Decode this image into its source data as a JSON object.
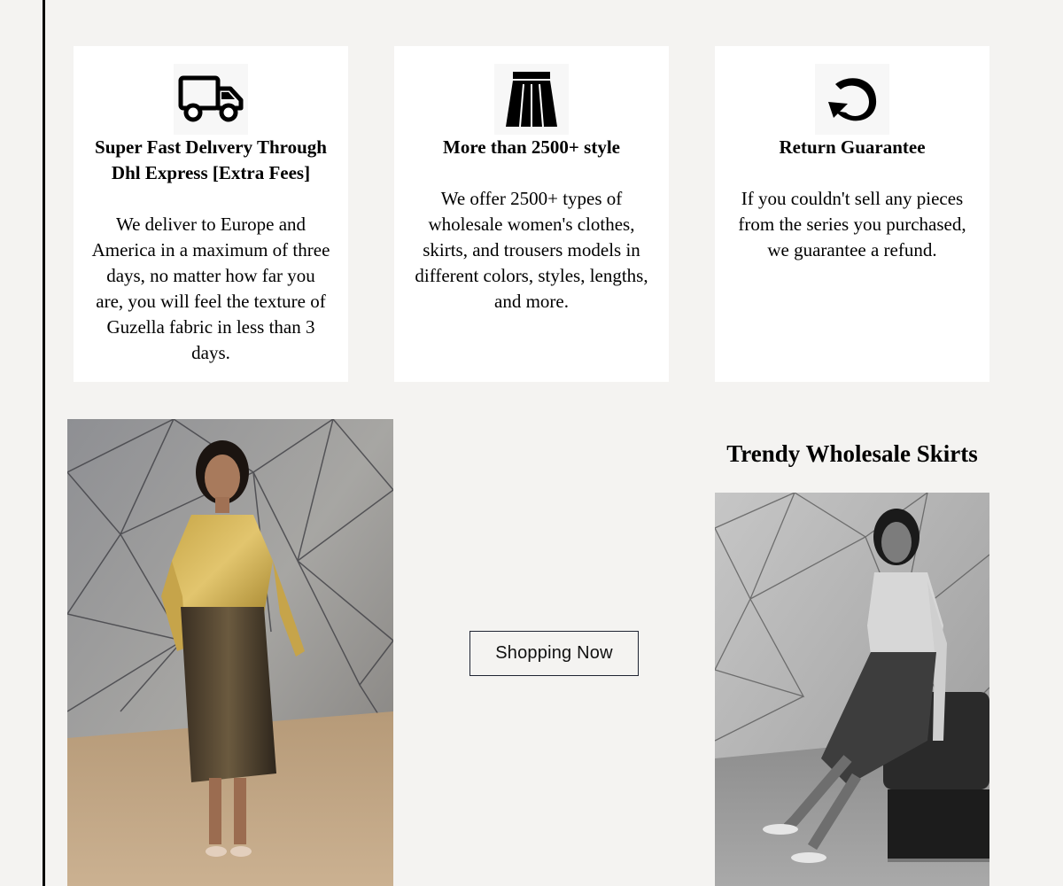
{
  "features": [
    {
      "icon": "delivery-truck-icon",
      "title": "Super Fast Delıvery Through Dhl Express [Extra Fees]",
      "description": "We deliver to Europe and America in a maximum of three days, no matter how far you are, you will feel the texture of Guzella fabric in less than 3 days."
    },
    {
      "icon": "skirt-icon",
      "title": "More than 2500+ style",
      "description": "We offer 2500+ types of wholesale women's clothes, skirts, and trousers models in different colors, styles, lengths, and more."
    },
    {
      "icon": "return-arrow-icon",
      "title": "Return Guarantee",
      "description": "If you couldn't sell any pieces from the series you purchased, we guarantee a refund."
    }
  ],
  "promo": {
    "button_label": "Shopping Now",
    "section_title": "Trendy Wholesale Skirts"
  },
  "colors": {
    "page_background": "#f4f3f1",
    "card_background": "#ffffff",
    "button_border": "#1f2433",
    "left_rule": "#000000"
  }
}
